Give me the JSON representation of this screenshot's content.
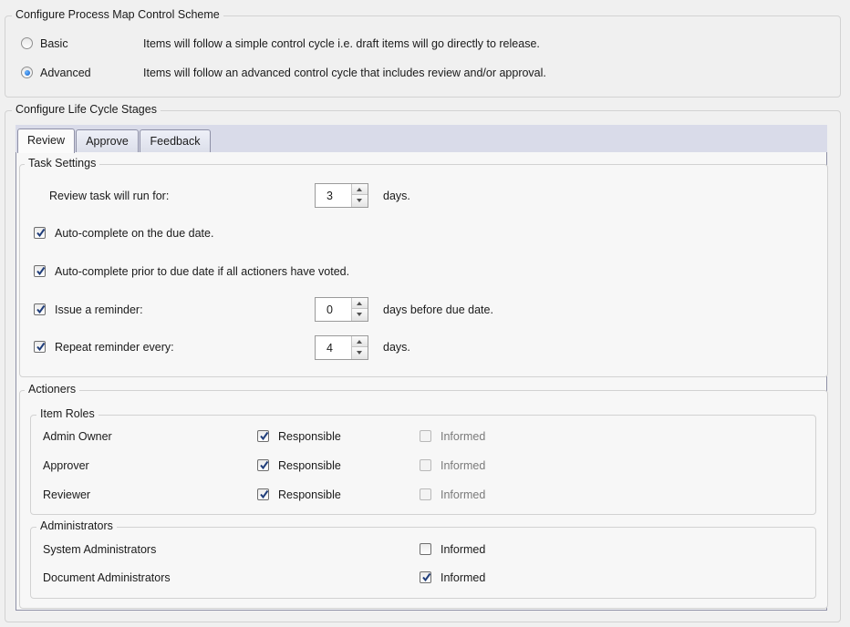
{
  "control_scheme": {
    "title": "Configure Process Map Control Scheme",
    "options": [
      {
        "label": "Basic",
        "description": "Items will follow a simple control cycle i.e. draft items will go directly to release.",
        "selected": false
      },
      {
        "label": "Advanced",
        "description": "Items will follow an advanced control cycle that includes review and/or approval.",
        "selected": true
      }
    ]
  },
  "life_cycle": {
    "title": "Configure Life Cycle Stages",
    "tabs": [
      {
        "label": "Review",
        "active": true
      },
      {
        "label": "Approve",
        "active": false
      },
      {
        "label": "Feedback",
        "active": false
      }
    ],
    "task_settings": {
      "title": "Task Settings",
      "run_for_label": "Review task will run for:",
      "run_for_value": "3",
      "run_for_unit": "days.",
      "auto_complete_due": {
        "label": "Auto-complete on the due date.",
        "checked": true
      },
      "auto_complete_prior": {
        "label": "Auto-complete prior to due date if all actioners have voted.",
        "checked": true
      },
      "reminder": {
        "label": "Issue a reminder:",
        "checked": true,
        "value": "0",
        "unit": "days before due date."
      },
      "repeat_reminder": {
        "label": "Repeat reminder every:",
        "checked": true,
        "value": "4",
        "unit": "days."
      }
    },
    "actioners": {
      "title": "Actioners",
      "item_roles": {
        "title": "Item Roles",
        "responsible_label": "Responsible",
        "informed_label": "Informed",
        "rows": [
          {
            "name": "Admin Owner",
            "responsible": true,
            "informed": false
          },
          {
            "name": "Approver",
            "responsible": true,
            "informed": false
          },
          {
            "name": "Reviewer",
            "responsible": true,
            "informed": false
          }
        ]
      },
      "administrators": {
        "title": "Administrators",
        "informed_label": "Informed",
        "rows": [
          {
            "name": "System Administrators",
            "informed": false
          },
          {
            "name": "Document Administrators",
            "informed": true
          }
        ]
      }
    }
  }
}
